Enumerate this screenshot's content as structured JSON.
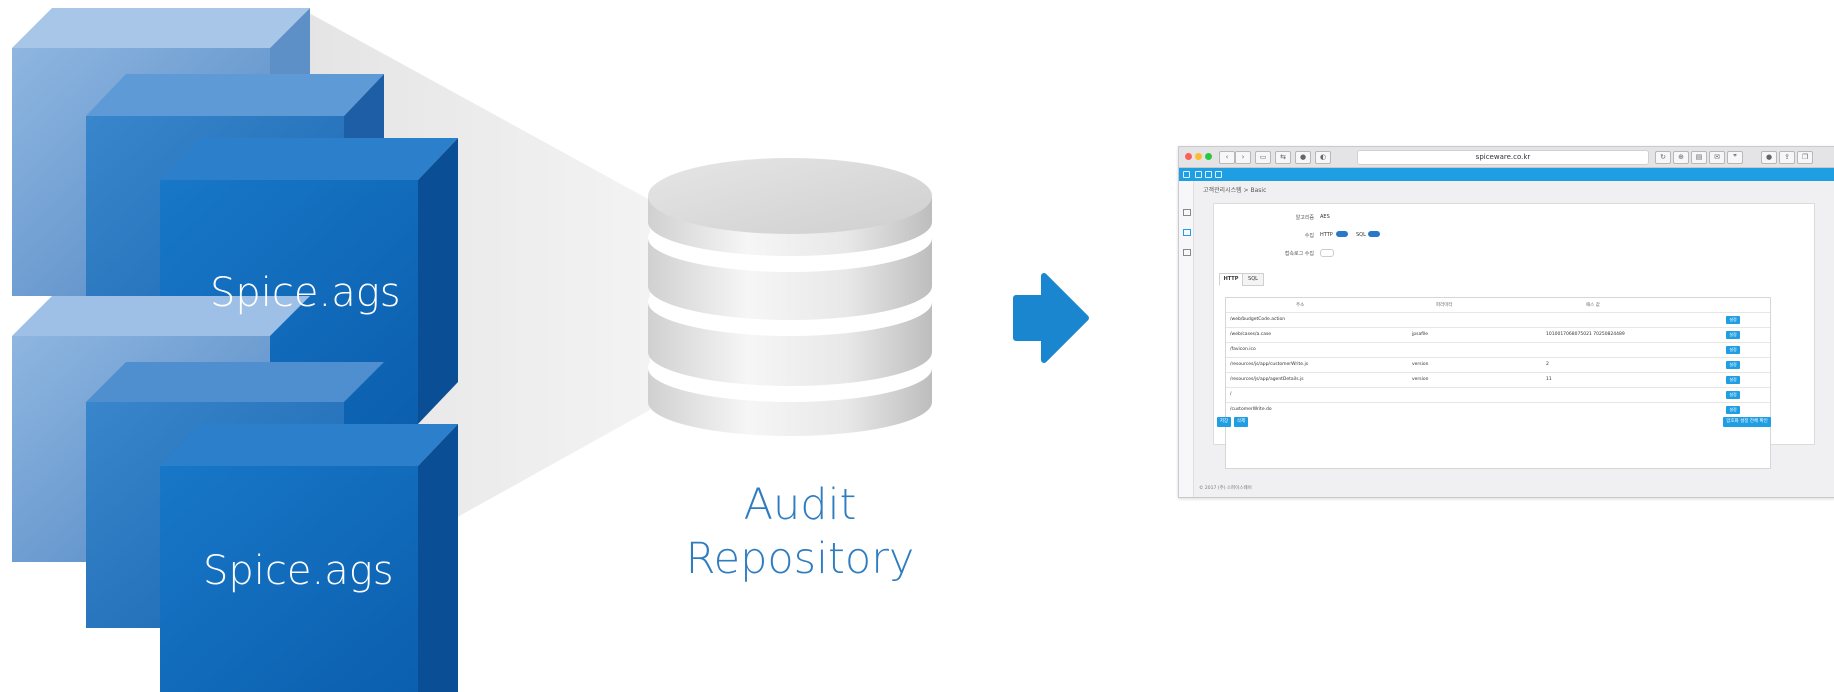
{
  "diagram": {
    "nodes": [
      {
        "id": "agent-1",
        "label": "Spice.ags"
      },
      {
        "id": "agent-2",
        "label": "Spice.ags"
      },
      {
        "id": "repository",
        "label_line1": "Audit",
        "label_line2": "Repository"
      },
      {
        "id": "screenshot",
        "label": ""
      }
    ],
    "edges": [
      {
        "from": "agent-1",
        "to": "repository"
      },
      {
        "from": "agent-2",
        "to": "repository"
      },
      {
        "from": "repository",
        "to": "screenshot"
      }
    ]
  },
  "colors": {
    "cube_front": "#0a64b8",
    "cube_back": "#6e9fd0",
    "arrow": "#1a86cf",
    "audit_text": "#2f7dc0",
    "browser_accent": "#1f9ee3"
  },
  "screenshot": {
    "url": "spiceware.co.kr",
    "breadcrumb": "고객관리시스템 > Basic",
    "fields": [
      {
        "label": "알고리즘",
        "value": "AES"
      },
      {
        "label": "수집",
        "http_label": "HTTP",
        "sql_label": "SQL"
      },
      {
        "label": "접속로그 수집"
      }
    ],
    "tabs": [
      "HTTP",
      "SQL"
    ],
    "columns": [
      "주소",
      "파라미터",
      "패스 값"
    ],
    "rows": [
      {
        "path": "/web/budgetCode.action",
        "param": "",
        "value": "",
        "btn": "설정"
      },
      {
        "path": "/web/cases/a.case",
        "param": "jpsafile",
        "value": "1010017068075021 70250824489",
        "btn": "설정"
      },
      {
        "path": "/favicon.ico",
        "param": "",
        "value": "",
        "btn": "설정"
      },
      {
        "path": "/resources/js/app/customerWrite.js",
        "param": "version",
        "value": "2",
        "btn": "설정"
      },
      {
        "path": "/resources/js/app/agentDetails.js",
        "param": "version",
        "value": "11",
        "btn": "설정"
      },
      {
        "path": "/",
        "param": "",
        "value": "",
        "btn": "설정"
      },
      {
        "path": "/customerWrite.do",
        "param": "",
        "value": "",
        "btn": "설정"
      }
    ],
    "buttons": {
      "save": "저장",
      "delete": "삭제",
      "apply": "암호화 설정 전체 확인"
    },
    "footer": "© 2017 (주) 스파이스웨어"
  }
}
